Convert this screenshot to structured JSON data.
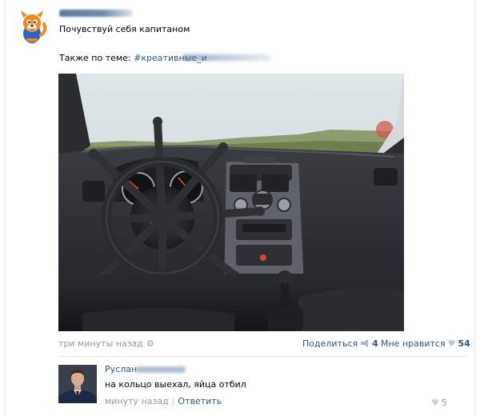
{
  "post": {
    "text": "Почувствуй себя капитаном",
    "related_prefix": "Также по теме: ",
    "related_link": "#креативные_и",
    "time": "три минуты назад",
    "share_label": "Поделиться",
    "share_count": "4",
    "like_label": "Мне нравится",
    "like_count": "54"
  },
  "comment": {
    "author": "Руслан",
    "text": "на кольцо выехал, яйца отбил",
    "time": "минуту назад",
    "separator": "|",
    "reply_label": "Ответить",
    "like_count": "5"
  },
  "icons": {
    "time": "gear-icon",
    "share": "megaphone-icon",
    "like": "heart-icon"
  },
  "colors": {
    "link": "#2b587a",
    "muted": "#999999",
    "divider": "#e7e8ec"
  }
}
